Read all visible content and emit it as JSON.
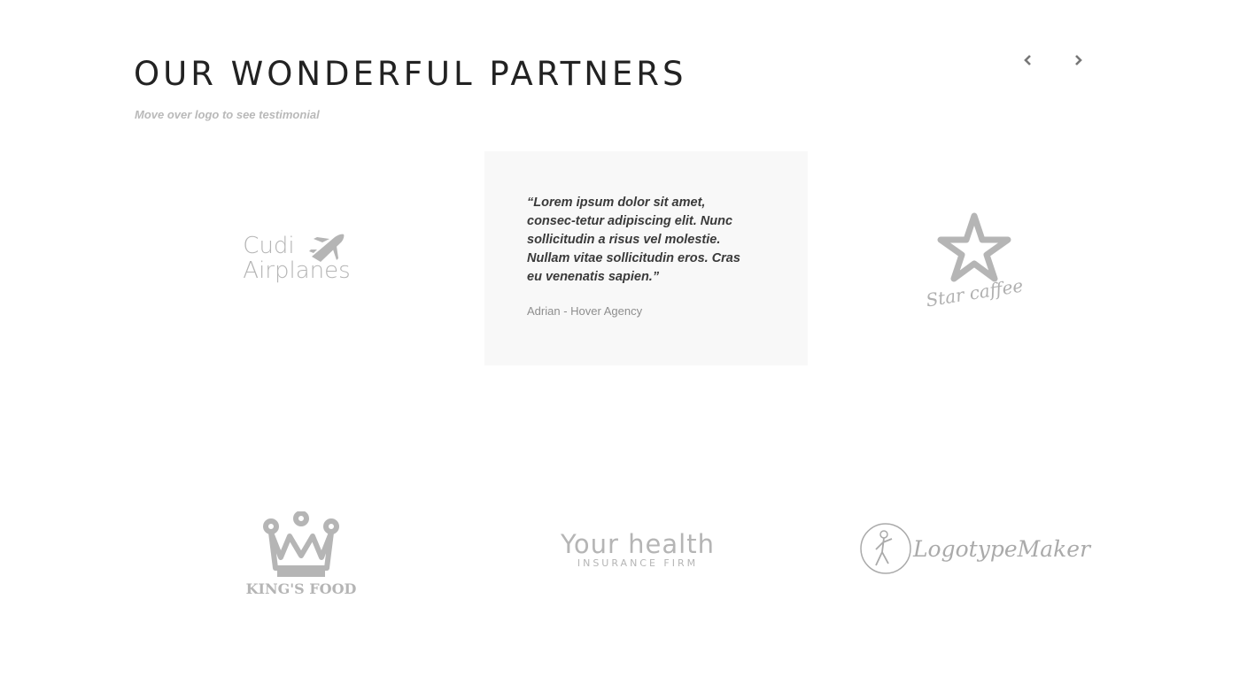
{
  "header": {
    "title": "OUR WONDERFUL PARTNERS",
    "subtitle": "Move over logo to see testimonial"
  },
  "nav": {
    "prev_icon": "chevron-left-icon",
    "next_icon": "chevron-right-icon"
  },
  "testimonial": {
    "quote": "“Lorem ipsum dolor sit amet, consec-tetur adipiscing elit. Nunc sollicitudin a risus vel molestie. Nullam vitae sollicitudin eros. Cras eu venenatis sapien.”",
    "author": "Adrian - Hover Agency"
  },
  "logos": {
    "cudi": {
      "line1": "Cudi",
      "line2": "Airplanes",
      "icon": "airplane-icon"
    },
    "star": {
      "text": "Star caffee",
      "icon": "star-icon"
    },
    "kings": {
      "text": "KING'S FOOD",
      "icon": "crown-icon"
    },
    "health": {
      "main": "Your health",
      "sub": "INSURANCE FIRM"
    },
    "maker": {
      "text": "LogotypeMaker",
      "icon": "figure-circle-icon"
    }
  },
  "colors": {
    "title": "#222222",
    "subtitle": "#b9b9b9",
    "logo_gray": "#b5b5b5",
    "testimonial_bg": "#f8f8f8"
  }
}
